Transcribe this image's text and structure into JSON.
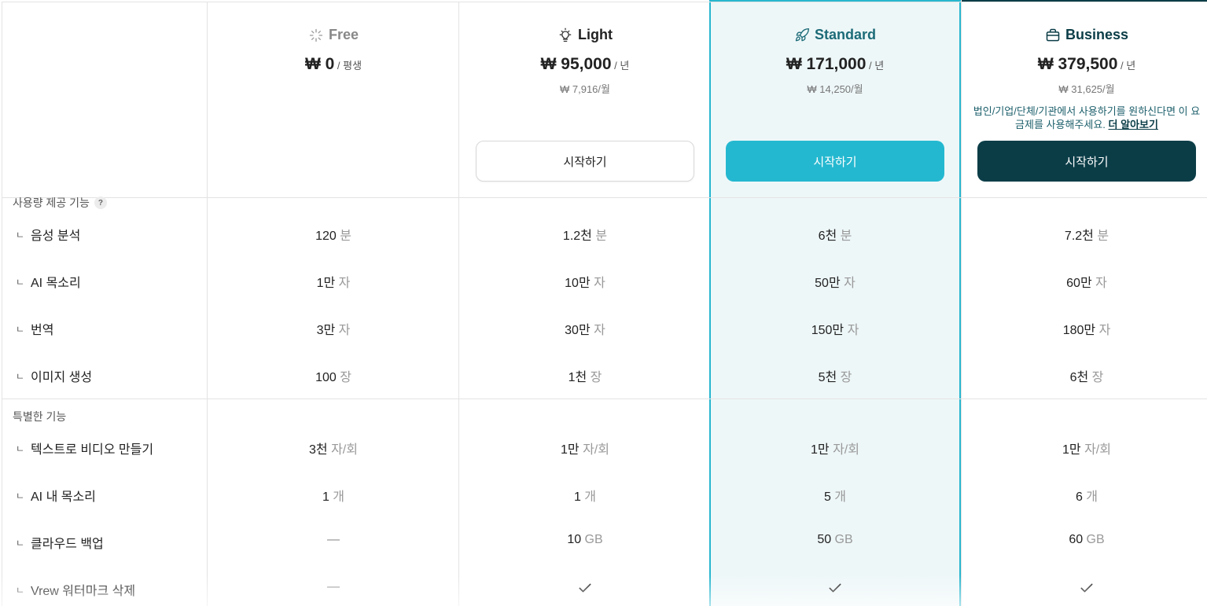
{
  "plans": [
    {
      "name": "Free",
      "icon": "sparkle-icon",
      "price": "₩ 0",
      "per": " / 평생",
      "monthly": "",
      "button": "",
      "name_color": "#888888"
    },
    {
      "name": "Light",
      "icon": "lightbulb-icon",
      "price": "₩ 95,000",
      "per": " / 년",
      "monthly": "₩ 7,916/월",
      "button": "시작하기",
      "name_color": "#222222"
    },
    {
      "name": "Standard",
      "icon": "rocket-icon",
      "price": "₩ 171,000",
      "per": " / 년",
      "monthly": "₩ 14,250/월",
      "button": "시작하기",
      "name_color": "#1c6b78"
    },
    {
      "name": "Business",
      "icon": "briefcase-icon",
      "price": "₩ 379,500",
      "per": " / 년",
      "monthly": "₩ 31,625/월",
      "button": "시작하기",
      "name_color": "#0b3d47",
      "note": "법인/기업/단체/기관에서 사용하기를 원하신다면 이 요금제를 사용해주세요.",
      "note_link": "더 알아보기"
    }
  ],
  "sections": {
    "usage": {
      "title": "사용량 제공 기능",
      "help": "?"
    },
    "special": {
      "title": "특별한 기능"
    }
  },
  "rows": [
    {
      "corner": "ㄴ",
      "label": "음성 분석",
      "values": [
        [
          "120",
          " 분"
        ],
        [
          "1.2천",
          " 분"
        ],
        [
          "6천",
          " 분"
        ],
        [
          "7.2천",
          " 분"
        ]
      ]
    },
    {
      "corner": "ㄴ",
      "label": "AI 목소리",
      "values": [
        [
          "1만",
          " 자"
        ],
        [
          "10만",
          " 자"
        ],
        [
          "50만",
          " 자"
        ],
        [
          "60만",
          " 자"
        ]
      ]
    },
    {
      "corner": "ㄴ",
      "label": "번역",
      "values": [
        [
          "3만",
          " 자"
        ],
        [
          "30만",
          " 자"
        ],
        [
          "150만",
          " 자"
        ],
        [
          "180만",
          " 자"
        ]
      ]
    },
    {
      "corner": "ㄴ",
      "label": "이미지 생성",
      "values": [
        [
          "100",
          " 장"
        ],
        [
          "1천",
          " 장"
        ],
        [
          "5천",
          " 장"
        ],
        [
          "6천",
          " 장"
        ]
      ]
    },
    {
      "corner": "ㄴ",
      "label": "텍스트로 비디오 만들기",
      "values": [
        [
          "3천",
          " 자/회"
        ],
        [
          "1만",
          " 자/회"
        ],
        [
          "1만",
          " 자/회"
        ],
        [
          "1만",
          " 자/회"
        ]
      ]
    },
    {
      "corner": "ㄴ",
      "label": "AI 내 목소리",
      "values": [
        [
          "1",
          " 개"
        ],
        [
          "1",
          " 개"
        ],
        [
          "5",
          " 개"
        ],
        [
          "6",
          " 개"
        ]
      ]
    },
    {
      "corner": "ㄴ",
      "label": "클라우드 백업",
      "values": [
        [
          "—",
          ""
        ],
        [
          "10",
          " GB"
        ],
        [
          "50",
          " GB"
        ],
        [
          "60",
          " GB"
        ]
      ]
    },
    {
      "corner": "ㄴ",
      "label": "Vrew 워터마크 삭제",
      "values": [
        [
          "—",
          ""
        ],
        [
          "✓",
          ""
        ],
        [
          "✓",
          ""
        ],
        [
          "✓",
          ""
        ]
      ]
    }
  ],
  "colors": {
    "accent": "#24b8d0",
    "dark": "#0b3d47",
    "highlight_bg": "#eef7f8"
  }
}
